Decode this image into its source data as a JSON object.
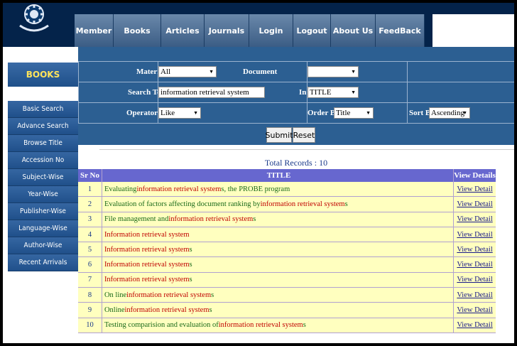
{
  "nav": {
    "items": [
      {
        "label": "Member",
        "width": 54
      },
      {
        "label": "Books",
        "width": 66
      },
      {
        "label": "Articles",
        "width": 60
      },
      {
        "label": "Journals",
        "width": 62
      },
      {
        "label": "Login",
        "width": 61
      },
      {
        "label": "Logout",
        "width": 52
      },
      {
        "label": "About Us",
        "width": 62
      },
      {
        "label": "FeedBack",
        "width": 68
      }
    ]
  },
  "sidebar": {
    "title": "BOOKS",
    "items": [
      "Basic Search",
      "Advance Search",
      "Browse Title",
      "Accession No",
      "Subject-Wise",
      "Year-Wise",
      "Publisher-Wise",
      "Language-Wise",
      "Author-Wise",
      "Recent Arrivals"
    ]
  },
  "search": {
    "material_label": "Material",
    "material_value": "All",
    "document_label": "Document",
    "document_value": "",
    "text_label": "Search Text",
    "text_value": "information retrieval system",
    "in_label": "In",
    "in_value": "TITLE",
    "operators_label": "Operators",
    "operators_value": "Like",
    "orderby_label": "Order By",
    "orderby_value": "Title",
    "sortby_label": "Sort By",
    "sortby_value": "Ascending",
    "submit_label": "Submit",
    "reset_label": "Reset"
  },
  "results": {
    "total": "Total Records : 10",
    "headers": {
      "sr": "Sr No",
      "title": "TITLE",
      "view": "View Details"
    },
    "rows": [
      {
        "sr": "1",
        "title": "Evaluating information retrieval systems, the PROBE program",
        "view": "View Detail"
      },
      {
        "sr": "2",
        "title": "Evaluation of factors affecting document ranking by information retrieval systems",
        "view": "View Detail"
      },
      {
        "sr": "3",
        "title": "File management and information retrieval systems",
        "view": "View Detail"
      },
      {
        "sr": "4",
        "title": "Information retrieval system",
        "view": "View Detail"
      },
      {
        "sr": "5",
        "title": "Information retrieval systems",
        "view": "View Detail"
      },
      {
        "sr": "6",
        "title": "Information retrieval systems",
        "view": "View Detail"
      },
      {
        "sr": "7",
        "title": "Information retrieval systems",
        "view": "View Detail"
      },
      {
        "sr": "8",
        "title": "On line information retrieval systems",
        "view": "View Detail"
      },
      {
        "sr": "9",
        "title": "Online information retrieval systems",
        "view": "View Detail"
      },
      {
        "sr": "10",
        "title": "Testing comparision and evaluation of information retrieval systems",
        "view": "View Detail"
      }
    ]
  },
  "colors": {
    "topbar": "#04234a",
    "search_bg": "#2c5f92",
    "row_bg": "#ffffbf",
    "header_bg": "#6767cf",
    "highlight": "#c00000"
  }
}
